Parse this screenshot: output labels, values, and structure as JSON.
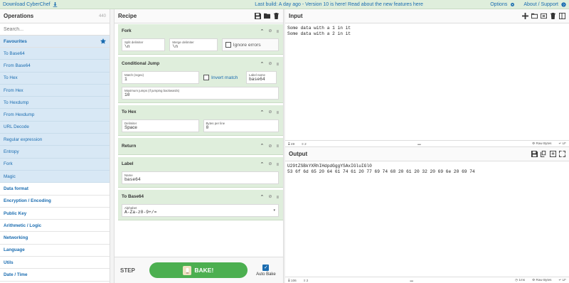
{
  "banner": {
    "download": "Download CyberChef",
    "build": "Last build: A day ago - Version 10 is here! Read about the new features here",
    "options": "Options",
    "about": "About / Support"
  },
  "operations": {
    "title": "Operations",
    "count": "440",
    "search_placeholder": "Search...",
    "favourites_label": "Favourites",
    "favourites": [
      "To Base64",
      "From Base64",
      "To Hex",
      "From Hex",
      "To Hexdump",
      "From Hexdump",
      "URL Decode",
      "Regular expression",
      "Entropy",
      "Fork",
      "Magic"
    ],
    "categories": [
      "Data format",
      "Encryption / Encoding",
      "Public Key",
      "Arithmetic / Logic",
      "Networking",
      "Language",
      "Utils",
      "Date / Time"
    ]
  },
  "recipe": {
    "title": "Recipe",
    "ops": {
      "fork": {
        "name": "Fork",
        "split_label": "Split delimiter",
        "split_value": "\\n",
        "merge_label": "Merge delimiter",
        "merge_value": "\\n",
        "ignore": "Ignore errors"
      },
      "jump": {
        "name": "Conditional Jump",
        "match_label": "Match (regex)",
        "match_value": "1",
        "invert": "Invert match",
        "label_label": "Label name",
        "label_value": "base64",
        "max_label": "Maximum jumps (if jumping backwards)",
        "max_value": "10"
      },
      "tohex": {
        "name": "To Hex",
        "delim_label": "Delimiter",
        "delim_value": "Space",
        "bpl_label": "Bytes per line",
        "bpl_value": "0"
      },
      "ret": {
        "name": "Return"
      },
      "label": {
        "name": "Label",
        "name_label": "Name",
        "name_value": "base64"
      },
      "tob64": {
        "name": "To Base64",
        "alpha_label": "Alphabet",
        "alpha_value": "A-Za-z0-9+/="
      }
    },
    "step": "STEP",
    "bake": "BAKE!",
    "autobake": "Auto Bake"
  },
  "input": {
    "title": "Input",
    "text": "Some data with a 1 in it\nSome data with a 2 in it",
    "status_chars": "49",
    "status_lines": "2",
    "status_enc": "Raw Bytes",
    "status_eol": "LF"
  },
  "output": {
    "title": "Output",
    "text": "U29tZSBkYXRhIHdpdGggYSAxIGluIGl0\n53 6f 6d 65 20 64 61 74 61 20 77 69 74 68 20 61 20 32 20 69 6e 20 69 74",
    "status_chars": "106",
    "status_lines": "2",
    "status_time": "1ms",
    "status_enc": "Raw Bytes",
    "status_eol": "LF"
  }
}
